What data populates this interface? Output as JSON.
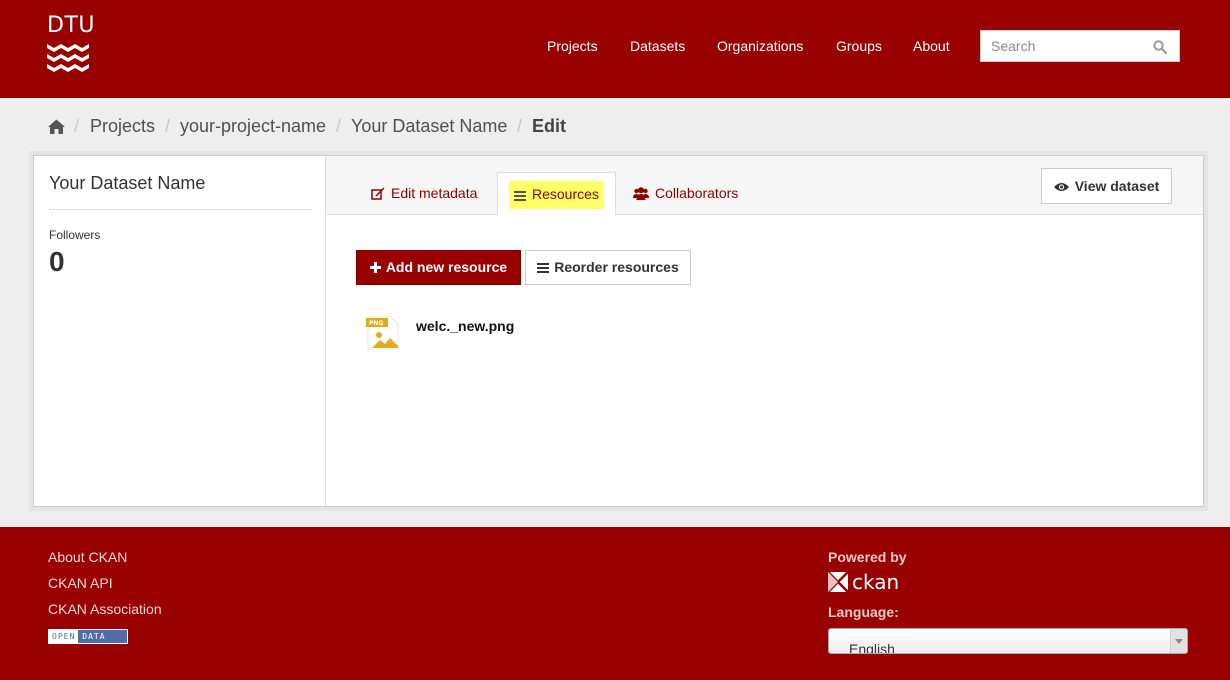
{
  "header": {
    "logo_text": "DTU",
    "nav": [
      {
        "label": "Projects"
      },
      {
        "label": "Datasets"
      },
      {
        "label": "Organizations"
      },
      {
        "label": "Groups"
      },
      {
        "label": "About"
      }
    ],
    "search": {
      "placeholder": "Search",
      "value": ""
    }
  },
  "breadcrumb": {
    "home_icon": "home-icon",
    "items": [
      "Projects",
      "your-project-name",
      "Your Dataset Name"
    ],
    "active": "Edit",
    "separator": "/"
  },
  "sidebar": {
    "dataset_title": "Your Dataset Name",
    "followers_label": "Followers",
    "followers_count": "0"
  },
  "tabs": [
    {
      "label": "Edit metadata",
      "icon": "edit-icon"
    },
    {
      "label": "Resources",
      "icon": "list-icon",
      "active": true
    },
    {
      "label": "Collaborators",
      "icon": "users-icon"
    }
  ],
  "view_dataset_label": "View dataset",
  "actions": {
    "add_resource": "Add new resource",
    "reorder_resources": "Reorder resources"
  },
  "resources": [
    {
      "name": "welc._new.png",
      "format": "PNG"
    }
  ],
  "footer": {
    "links": [
      "About CKAN",
      "CKAN API",
      "CKAN Association"
    ],
    "open_data_badge": {
      "left": "OPEN",
      "right": "DATA"
    },
    "powered_by": "Powered by",
    "ckan_logo_text": "ckan",
    "language_label": "Language:",
    "language_value": "English"
  },
  "colors": {
    "brand": "#990000",
    "highlight": "#ffff66",
    "link": "#8b0000"
  }
}
